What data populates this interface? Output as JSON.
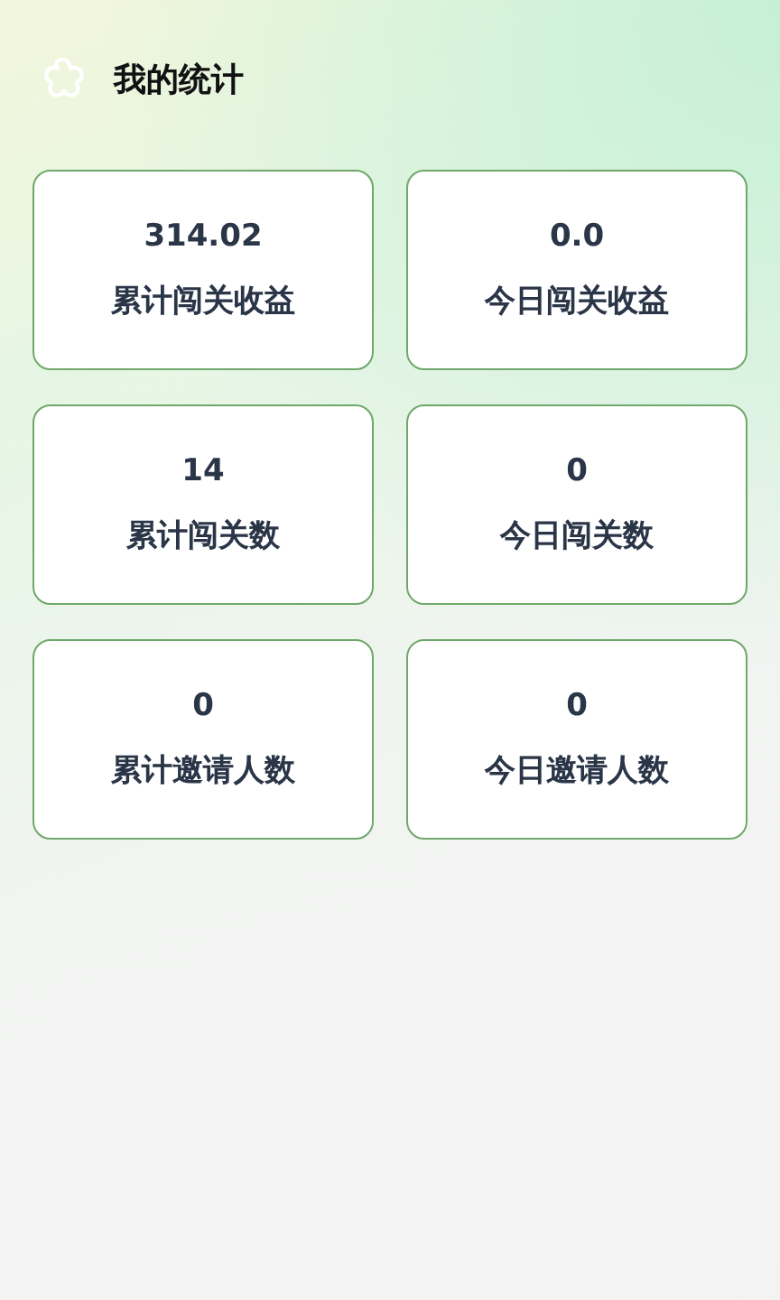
{
  "header": {
    "title": "我的统计"
  },
  "stats": [
    {
      "value": "314.02",
      "label": "累计闯关收益"
    },
    {
      "value": "0.0",
      "label": "今日闯关收益"
    },
    {
      "value": "14",
      "label": "累计闯关数"
    },
    {
      "value": "0",
      "label": "今日闯关数"
    },
    {
      "value": "0",
      "label": "累计邀请人数"
    },
    {
      "value": "0",
      "label": "今日邀请人数"
    }
  ]
}
